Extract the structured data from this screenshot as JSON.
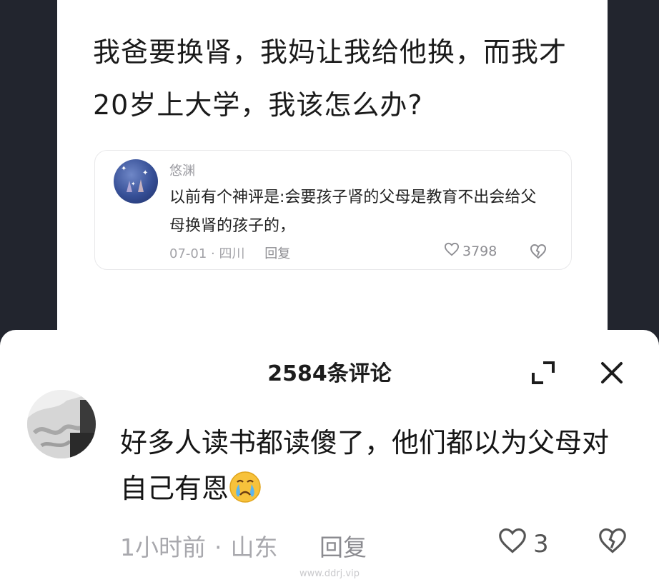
{
  "post": {
    "title": "我爸要换肾，我妈让我给他换，而我才20岁上大学，我该怎么办?"
  },
  "quoted_comment": {
    "username": "悠渊",
    "text": "以前有个神评是:会要孩子肾的父母是教育不出会给父母换肾的孩子的，",
    "date": "07-01",
    "location": "四川",
    "reply_label": "回复",
    "likes": "3798"
  },
  "comments_sheet": {
    "title": "2584条评论",
    "comment": {
      "text": "好多人读书都读傻了，他们都以为父母对自己有恩",
      "time": "1小时前",
      "location": "山东",
      "reply_label": "回复",
      "likes": "3"
    },
    "watermark": "www.ddrj.vip"
  }
}
